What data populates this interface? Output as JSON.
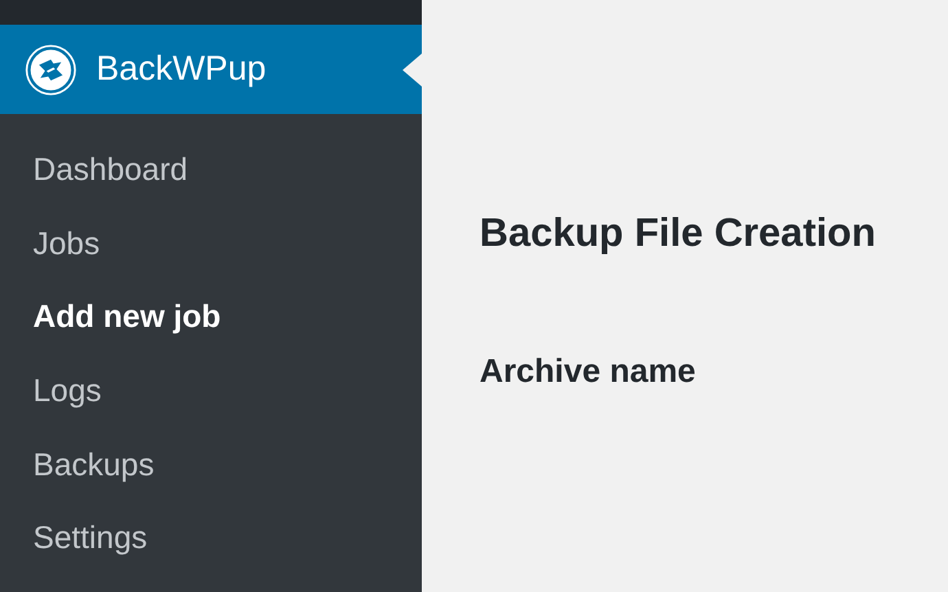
{
  "sidebar": {
    "menu_title": "BackWPup",
    "items": [
      {
        "label": "Dashboard",
        "selected": false
      },
      {
        "label": "Jobs",
        "selected": false
      },
      {
        "label": "Add new job",
        "selected": true
      },
      {
        "label": "Logs",
        "selected": false
      },
      {
        "label": "Backups",
        "selected": false
      },
      {
        "label": "Settings",
        "selected": false
      }
    ]
  },
  "main": {
    "heading": "Backup File Creation",
    "section_label": "Archive name"
  }
}
